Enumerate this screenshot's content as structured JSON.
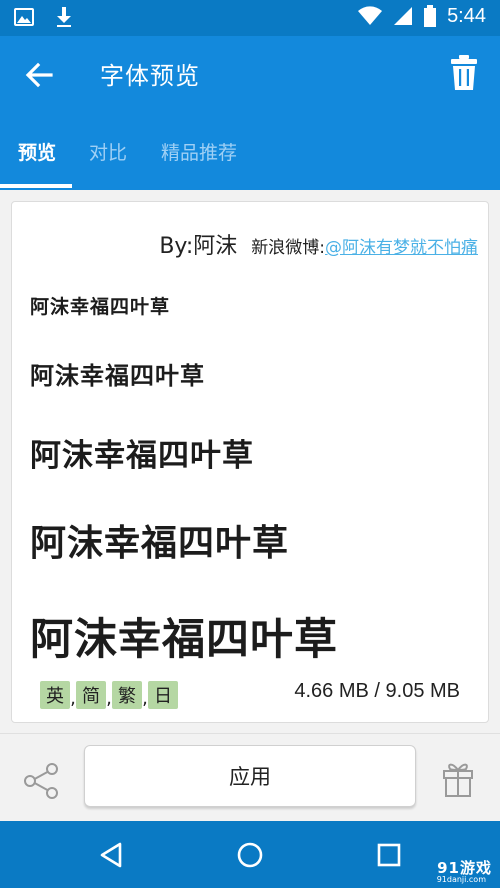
{
  "status_bar": {
    "time": "5:44",
    "icons": [
      "image-icon",
      "download-icon",
      "wifi-icon",
      "signal-icon",
      "battery-icon"
    ]
  },
  "app_bar": {
    "title": "字体预览",
    "icons": [
      "back-arrow-icon",
      "trash-icon"
    ]
  },
  "tabs": [
    {
      "label": "预览",
      "active": true
    },
    {
      "label": "对比",
      "active": false
    },
    {
      "label": "精品推荐",
      "active": false
    }
  ],
  "preview": {
    "author": "By:阿沫",
    "weibo_label": "新浪微博:",
    "weibo_link": "@阿沫有梦就不怕痛",
    "sample_text": "阿沫幸福四叶草",
    "sample_count": 5,
    "languages": [
      "英",
      "简",
      "繁",
      "日"
    ],
    "language_separator": ",",
    "size_info": "4.66 MB / 9.05 MB"
  },
  "bottom_bar": {
    "apply_label": "应用",
    "icons": [
      "share-icon",
      "gift-icon"
    ]
  },
  "nav_bar": {
    "icons": [
      "nav-back-icon",
      "nav-home-icon",
      "nav-recents-icon"
    ]
  },
  "watermark": {
    "text": "91游戏",
    "subtext": "91danji.com"
  },
  "colors": {
    "primary": "#1389dc",
    "status_bar": "#0a7ac4",
    "link": "#4bb1e6",
    "tag_bg": "#b5d7a3"
  }
}
